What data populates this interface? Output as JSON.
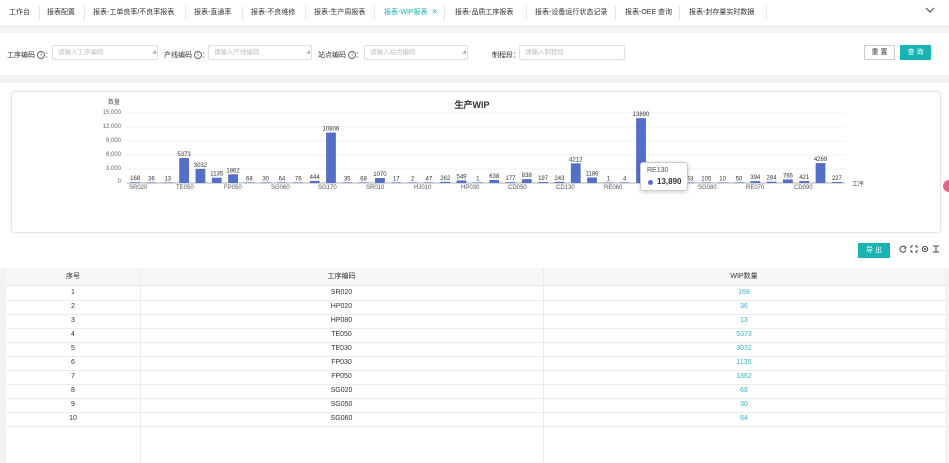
{
  "tabs": [
    {
      "label": "工作台"
    },
    {
      "label": "报表配置"
    },
    {
      "label": "报表-工单良率/不良率报表"
    },
    {
      "label": "报表-直通率"
    },
    {
      "label": "报表-不良维修"
    },
    {
      "label": "报表-生产周报表"
    },
    {
      "label": "报表-WIP报表",
      "active": true,
      "close": "✕"
    },
    {
      "label": "报表-品质工序报表"
    },
    {
      "label": "报表-设备运行状态记录"
    },
    {
      "label": "报表-OEE 查询"
    },
    {
      "label": "报表-封存量实时数据"
    }
  ],
  "tab_menu_icon": "chevron-down-icon",
  "filters": {
    "process_code": {
      "label": "工序编码",
      "placeholder": "请输入工序编码"
    },
    "line_code": {
      "label": "产线编码",
      "placeholder": "请输入产线编码"
    },
    "station_code": {
      "label": "站点编码",
      "placeholder": "请输入站点编码"
    },
    "process_segment": {
      "label": "制程段：",
      "placeholder": "请输入制程段"
    },
    "reset_label": "重 置",
    "query_label": "查 询"
  },
  "chart_data": {
    "type": "bar",
    "title": "生产WIP",
    "ylabel": "数量",
    "xlabel": "工序",
    "ylim": [
      0,
      15000
    ],
    "yticks": [
      "15,000",
      "12,000",
      "9,000",
      "6,000",
      "3,000",
      "0"
    ],
    "xtick_labels": [
      "SR020",
      "TE050",
      "FP050",
      "SG060",
      "SG170",
      "SR010",
      "HJ010",
      "HP030",
      "CD050",
      "CD130",
      "RE060",
      "SG080",
      "RE070",
      "CD090"
    ],
    "values": [
      168,
      36,
      13,
      5373,
      3032,
      1135,
      1862,
      68,
      30,
      64,
      76,
      444,
      10806,
      35,
      68,
      1070,
      17,
      2,
      47,
      262,
      549,
      1,
      638,
      177,
      838,
      197,
      243,
      4212,
      1186,
      1,
      4,
      13890,
      0,
      0,
      63,
      105,
      10,
      50,
      394,
      284,
      766,
      421,
      4269,
      227
    ],
    "label_hidden_indices": [
      32,
      33
    ],
    "bar_color": "#5470c6",
    "tooltip": {
      "category": "RE130",
      "value": "13,890"
    }
  },
  "toolbar": {
    "export_label": "导 出",
    "icons": [
      "refresh-icon",
      "fullscreen-icon",
      "settings-icon",
      "column-icon"
    ]
  },
  "table": {
    "headers": [
      "序号",
      "工序编码",
      "WIP数量"
    ],
    "rows": [
      [
        "1",
        "SR020",
        "168"
      ],
      [
        "2",
        "HP020",
        "36"
      ],
      [
        "3",
        "HP080",
        "13"
      ],
      [
        "4",
        "TE050",
        "5373"
      ],
      [
        "5",
        "TE030",
        "3032"
      ],
      [
        "6",
        "FP030",
        "1135"
      ],
      [
        "7",
        "FP050",
        "1862"
      ],
      [
        "8",
        "SG020",
        "68"
      ],
      [
        "9",
        "SG050",
        "30"
      ],
      [
        "10",
        "SG060",
        "64"
      ]
    ]
  },
  "colors": {
    "accent": "#1ab3b3",
    "value_link": "#3bb3c7",
    "bar": "#5470c6"
  }
}
